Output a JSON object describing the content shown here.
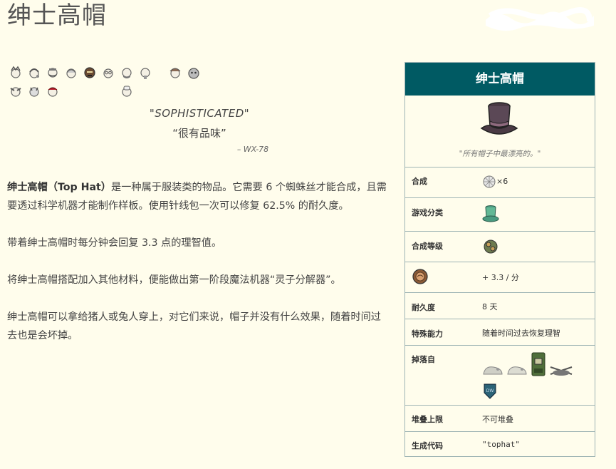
{
  "page": {
    "title": "绅士高帽"
  },
  "characters": {
    "icons": [
      "wilson-icon",
      "willow-icon",
      "wolfgang-icon",
      "wendy-icon",
      "wx78-icon",
      "wickerbottom-icon",
      "woodie-icon",
      "wes-icon",
      "wigfrid-icon",
      "webber-icon",
      "winona-icon",
      "wortox-icon",
      "wormwood-icon",
      "warly-icon"
    ]
  },
  "quote": {
    "text_en": "\"SOPHISTICATED\"",
    "text_zh": "“很有品味”",
    "speaker": "– WX-78"
  },
  "description": {
    "p1_bold": "绅士高帽（Top Hat）",
    "p1_rest": "是一种属于服装类的物品。它需要 6 个蜘蛛丝才能合成，且需要透过科学机器才能制作样板。使用针线包一次可以修复 62.5% 的耐久度。",
    "p2": "带着绅士高帽时每分钟会回复 3.3 点的理智值。",
    "p3": "将绅士高帽搭配加入其他材料，便能做出第一阶段魔法机器“灵子分解器”。",
    "p4": "绅士高帽可以拿给猪人或兔人穿上，对它们来说，帽子并没有什么效果，随着时间过去也是会坏掉。"
  },
  "infobox": {
    "title": "绅士高帽",
    "caption": "\"所有帽子中最漂亮的。\"",
    "rows": {
      "craft_label": "合成",
      "craft_value": "×6",
      "category_label": "游戏分类",
      "tier_label": "合成等级",
      "sanity_value": "+ 3.3 / 分",
      "durability_label": "耐久度",
      "durability_value": "8 天",
      "ability_label": "特殊能力",
      "ability_value": "随着时间过去恢复理智",
      "drop_label": "掉落自",
      "stack_label": "堆叠上限",
      "stack_value": "不可堆叠",
      "code_label": "生成代码",
      "code_value": "\"tophat\""
    }
  },
  "colors": {
    "background": "#fffdec",
    "infobox_header": "#005a63",
    "border": "#9eb4b4"
  }
}
